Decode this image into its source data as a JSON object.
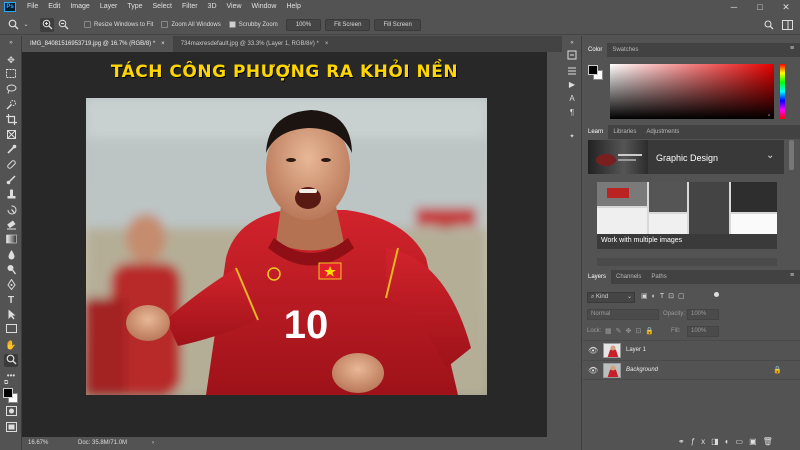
{
  "menubar": {
    "logo": "Ps",
    "items": [
      "File",
      "Edit",
      "Image",
      "Layer",
      "Type",
      "Select",
      "Filter",
      "3D",
      "View",
      "Window",
      "Help"
    ]
  },
  "window_controls": {
    "minimize": "─",
    "maximize": "□",
    "close": "✕"
  },
  "options": {
    "resize_windows": "Resize Windows to Fit",
    "zoom_all": "Zoom All Windows",
    "scrubby_zoom": "Scrubby Zoom",
    "zoom_value": "100%",
    "fit_screen": "Fit Screen",
    "fill_screen": "Fill Screen"
  },
  "tabs": [
    {
      "label": "IMG_84081516953719.jpg @ 16.7% (RGB/8) *",
      "close": "×"
    },
    {
      "label": "734maxresdefault.jpg @ 33.3% (Layer 1, RGB/8#) *",
      "close": "×"
    }
  ],
  "canvas": {
    "headline": "TÁCH CÔNG PHƯỢNG RA KHỎI NỀN",
    "jersey_number": "10"
  },
  "status": {
    "zoom": "16.67%",
    "doc": "Doc: 35.8M/71.0M",
    "arrow": "›"
  },
  "color_panel": {
    "tabs": [
      "Color",
      "Swatches"
    ]
  },
  "learn_panel": {
    "tabs": [
      "Learn",
      "Libraries",
      "Adjustments"
    ],
    "section_title": "Graphic Design",
    "card_title": "Work with multiple images"
  },
  "layers_panel": {
    "tabs": [
      "Layers",
      "Channels",
      "Paths"
    ],
    "kind_label": "Kind",
    "blend_mode": "Normal",
    "opacity_label": "Opacity:",
    "opacity_value": "100%",
    "lock_label": "Lock:",
    "fill_label": "Fill:",
    "fill_value": "100%",
    "layers": [
      {
        "name": "Layer 1",
        "visible": true,
        "locked": false
      },
      {
        "name": "Background",
        "visible": true,
        "locked": true
      }
    ]
  },
  "colors": {
    "headline": "#ffd600",
    "jersey_red": "#c8202a",
    "ps_blue": "#31a8ff"
  }
}
